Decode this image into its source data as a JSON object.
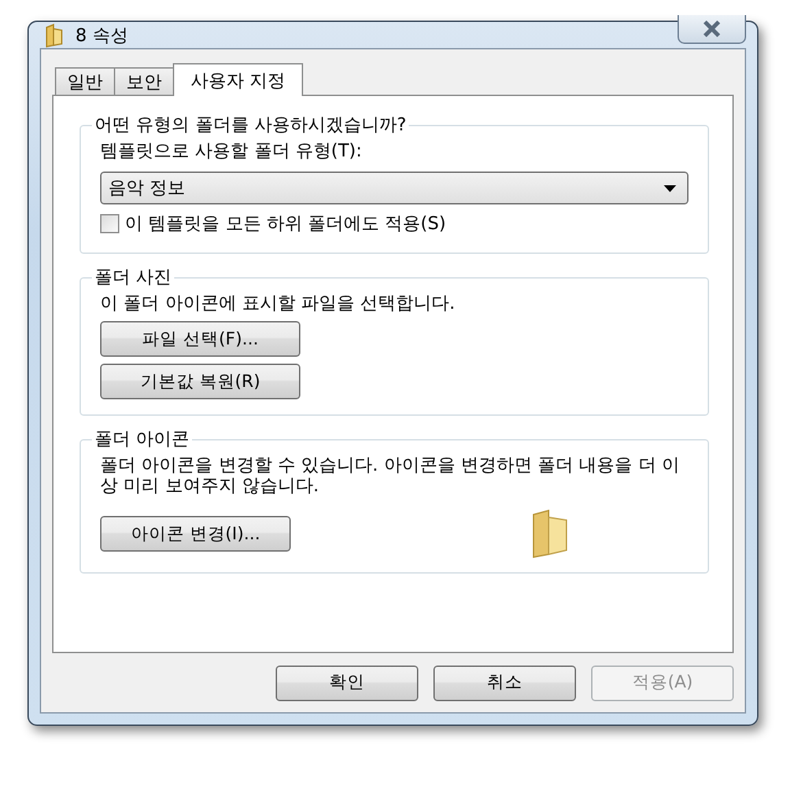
{
  "window": {
    "title": "8 속성"
  },
  "tabs": [
    {
      "label": "일반",
      "selected": false
    },
    {
      "label": "보안",
      "selected": false
    },
    {
      "label": "사용자 지정",
      "selected": true
    }
  ],
  "groups": [
    {
      "title": "어떤 유형의 폴더를 사용하시겠습니까?",
      "items": [
        {
          "kind": "label",
          "text": "템플릿으로 사용할 폴더 유형(T):"
        },
        {
          "kind": "dropdown",
          "value": "음악 정보"
        },
        {
          "kind": "checkbox",
          "label": "이 템플릿을 모든 하위 폴더에도 적용(S)",
          "checked": false
        }
      ]
    },
    {
      "title": "폴더 사진",
      "items": [
        {
          "kind": "label",
          "text": "이 폴더 아이콘에 표시할 파일을 선택합니다."
        },
        {
          "kind": "button",
          "label": "파일 선택(F)..."
        },
        {
          "kind": "button",
          "label": "기본값 복원(R)"
        }
      ]
    },
    {
      "title": "폴더 아이콘",
      "items": [
        {
          "kind": "label",
          "text": "폴더 아이콘을 변경할 수 있습니다. 아이콘을 변경하면 폴더 내용을 더 이상 미리 보여주지 않습니다."
        },
        {
          "kind": "button_preview",
          "label": "아이콘 변경(I)..."
        }
      ]
    }
  ],
  "buttons": [
    {
      "label": "확인",
      "disabled": false
    },
    {
      "label": "취소",
      "disabled": false
    },
    {
      "label": "적용(A)",
      "disabled": true
    }
  ]
}
